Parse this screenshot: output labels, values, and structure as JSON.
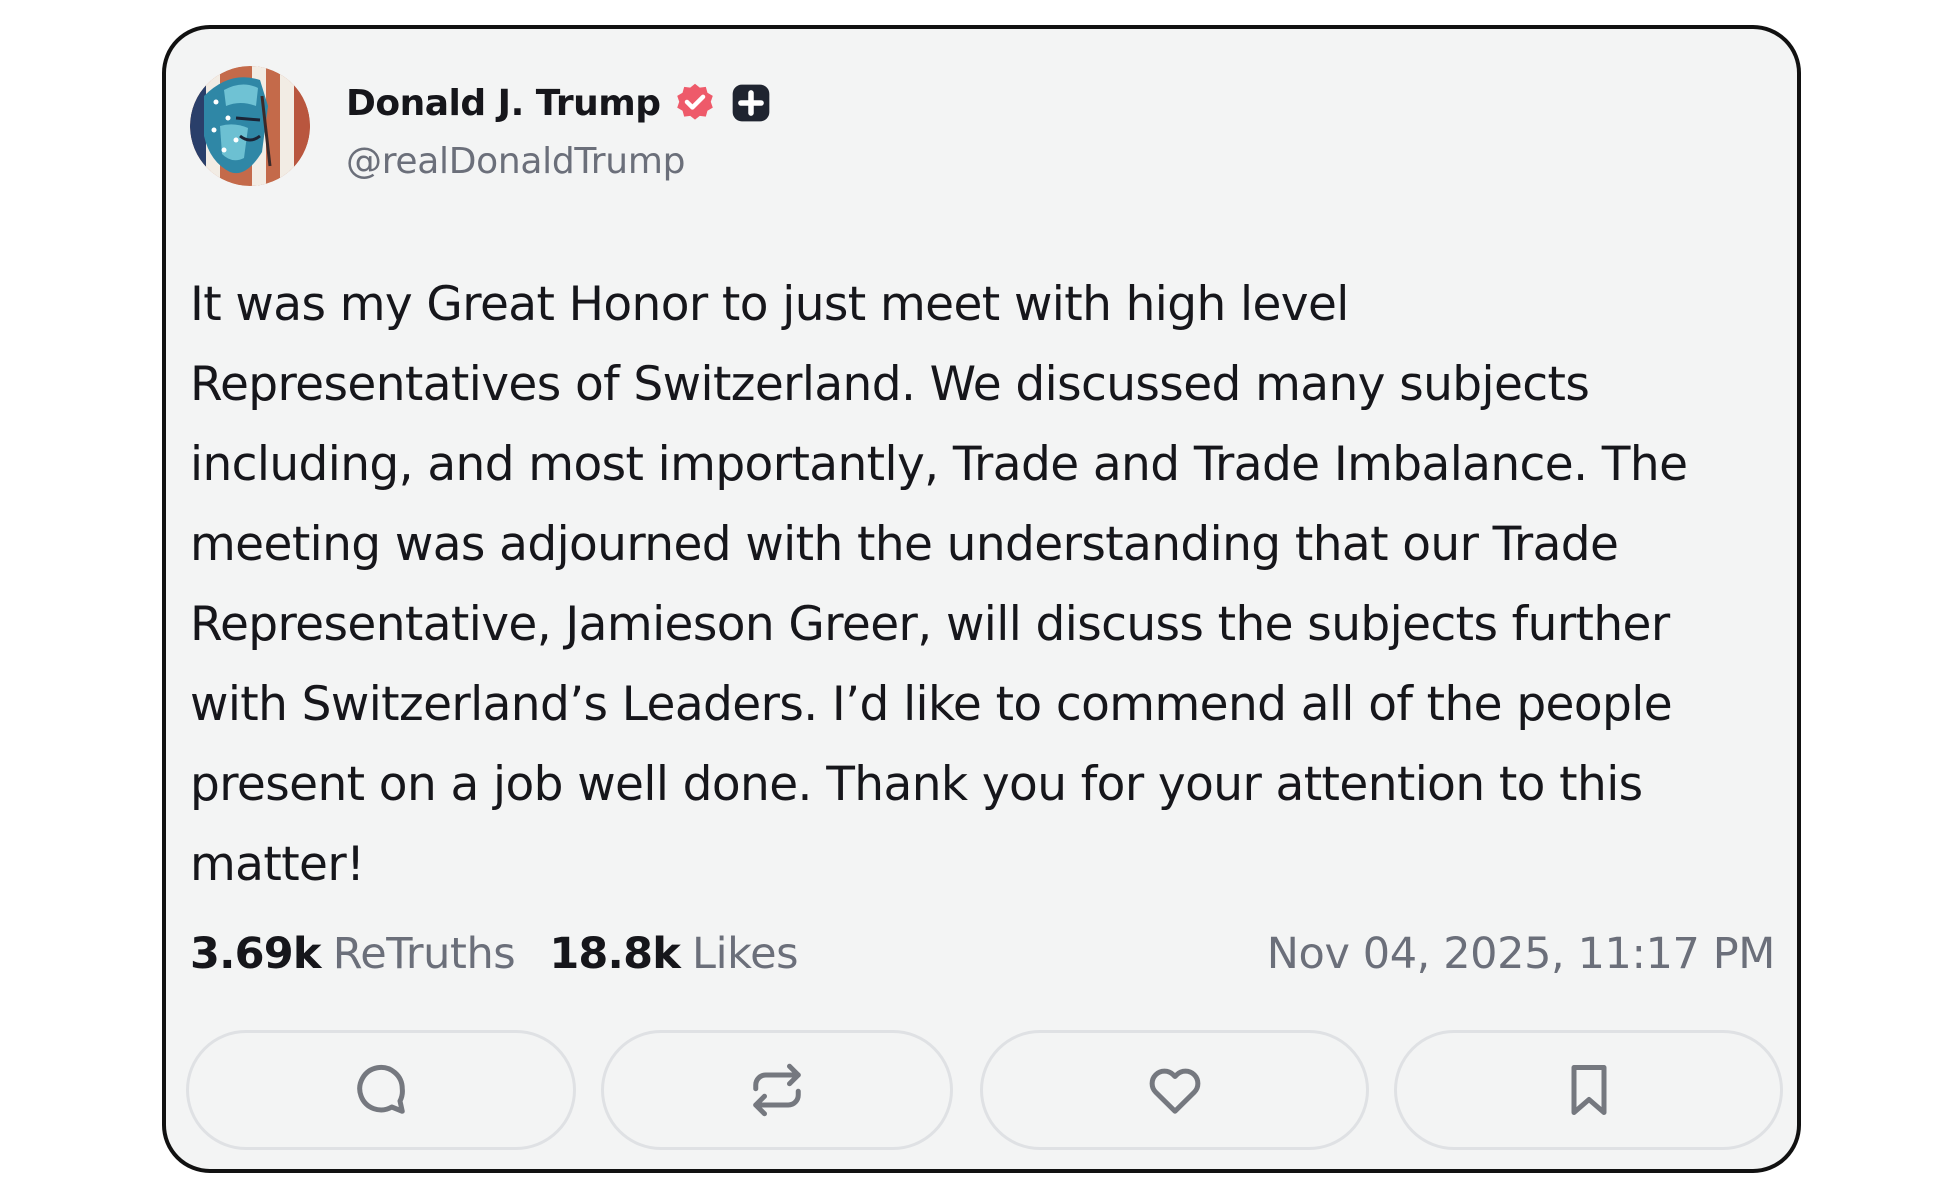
{
  "author": {
    "display_name": "Donald J. Trump",
    "handle": "@realDonaldTrump",
    "avatar_icon": "avatar-flag-portrait",
    "verified_icon": "verified-badge-icon",
    "verified_color": "#ee5a6a",
    "extra_badge_icon": "plus-square-icon"
  },
  "post": {
    "lines": [
      "It was my Great Honor to just meet with high level",
      "Representatives of Switzerland. We discussed many subjects",
      "including, and most importantly, Trade and Trade Imbalance. The",
      "meeting was adjourned with the understanding that our Trade",
      "Representative, Jamieson Greer, will discuss the subjects further",
      "with Switzerland’s Leaders. I’d like to commend all of the people",
      "present on a job well done. Thank you for your attention to this",
      "matter!"
    ]
  },
  "stats": {
    "retruths_count": "3.69k",
    "retruths_label": "ReTruths",
    "likes_count": "18.8k",
    "likes_label": "Likes",
    "timestamp": "Nov 04, 2025, 11:17 PM"
  },
  "actions": [
    {
      "name": "reply",
      "icon": "comment-icon"
    },
    {
      "name": "retruth",
      "icon": "repost-icon"
    },
    {
      "name": "like",
      "icon": "heart-icon"
    },
    {
      "name": "bookmark",
      "icon": "bookmark-icon"
    }
  ],
  "colors": {
    "card_background": "#f3f4f4",
    "text_primary": "#16161b",
    "text_secondary": "#6b6f7a",
    "icon_gray": "#75787f"
  }
}
